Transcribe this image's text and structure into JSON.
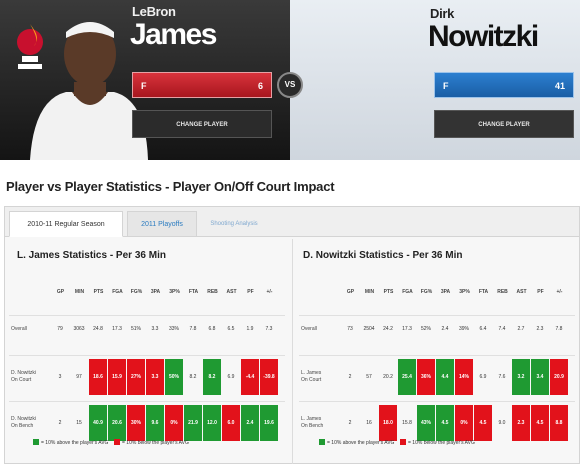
{
  "colors": {
    "heat_red": "#d8333c",
    "mavs_blue": "#2c7fd0",
    "above_avg_green": "#1f9a32",
    "below_avg_red": "#e2121b"
  },
  "player1": {
    "first": "LeBron",
    "last": "James",
    "position": "F",
    "number": "6",
    "change": "CHANGE PLAYER",
    "team_logo": "heat-logo-icon"
  },
  "player2": {
    "first": "Dirk",
    "last": "Nowitzki",
    "position": "F",
    "number": "41",
    "change": "CHANGE PLAYER",
    "team_logo": "mavericks-logo-icon"
  },
  "vs": "VS",
  "title": "Player vs Player Statistics - Player On/Off Court Impact",
  "tabs": [
    "2010-11 Regular Season",
    "2011 Playoffs",
    "Shooting Analysis"
  ],
  "columns": [
    "GP",
    "MIN",
    "PTS",
    "FGA",
    "FG%",
    "3PA",
    "3P%",
    "FTA",
    "REB",
    "AST",
    "PF",
    "+/-"
  ],
  "left": {
    "title": "L. James Statistics - Per 36 Min",
    "rows": [
      {
        "label": [
          "Overall"
        ],
        "values": [
          "79",
          "3063",
          "24.8",
          "17.3",
          "51%",
          "3.3",
          "33%",
          "7.8",
          "6.8",
          "6.5",
          "1.9",
          "7.3"
        ],
        "colors": [
          "",
          "",
          "",
          "",
          "",
          "",
          "",
          "",
          "",
          "",
          "",
          ""
        ]
      },
      {
        "label": [
          "D. Nowitzki",
          "On Court"
        ],
        "values": [
          "3",
          "97",
          "18.6",
          "15.9",
          "27%",
          "3.3",
          "50%",
          "8.2",
          "8.2",
          "6.9",
          "-4.4",
          "-39.8"
        ],
        "colors": [
          "",
          "",
          "r",
          "r",
          "r",
          "r",
          "g",
          "",
          "g",
          "",
          "r",
          "r"
        ]
      },
      {
        "label": [
          "D. Nowitzki",
          "On Bench"
        ],
        "values": [
          "2",
          "15",
          "40.9",
          "20.6",
          "30%",
          "9.6",
          "0%",
          "21.9",
          "12.0",
          "6.0",
          "2.4",
          "19.6"
        ],
        "colors": [
          "",
          "",
          "g",
          "g",
          "r",
          "g",
          "r",
          "g",
          "g",
          "r",
          "g",
          "g"
        ]
      }
    ],
    "legend_above": "= 10% above the player's AVG",
    "legend_below": "= 10% below the player's AVG"
  },
  "right": {
    "title": "D. Nowitzki Statistics - Per 36 Min",
    "rows": [
      {
        "label": [
          "Overall"
        ],
        "values": [
          "73",
          "2504",
          "24.2",
          "17.3",
          "52%",
          "2.4",
          "39%",
          "6.4",
          "7.4",
          "2.7",
          "2.3",
          "7.8"
        ],
        "colors": [
          "",
          "",
          "",
          "",
          "",
          "",
          "",
          "",
          "",
          "",
          "",
          ""
        ]
      },
      {
        "label": [
          "L. James",
          "On Court"
        ],
        "values": [
          "2",
          "57",
          "20.2",
          "25.4",
          "36%",
          "4.4",
          "14%",
          "6.9",
          "7.6",
          "3.2",
          "3.4",
          "20.9"
        ],
        "colors": [
          "",
          "",
          "",
          "g",
          "r",
          "g",
          "r",
          "",
          "",
          "g",
          "g",
          "r"
        ]
      },
      {
        "label": [
          "L. James",
          "On Bench"
        ],
        "values": [
          "2",
          "16",
          "18.0",
          "15.8",
          "43%",
          "4.5",
          "0%",
          "4.5",
          "9.0",
          "2.3",
          "4.5",
          "8.8"
        ],
        "colors": [
          "",
          "",
          "r",
          "",
          "g",
          "g",
          "r",
          "r",
          "",
          "r",
          "r",
          "r"
        ]
      }
    ],
    "legend_above": "= 10% above the player's AVG",
    "legend_below": "= 10% below the player's AVG"
  }
}
